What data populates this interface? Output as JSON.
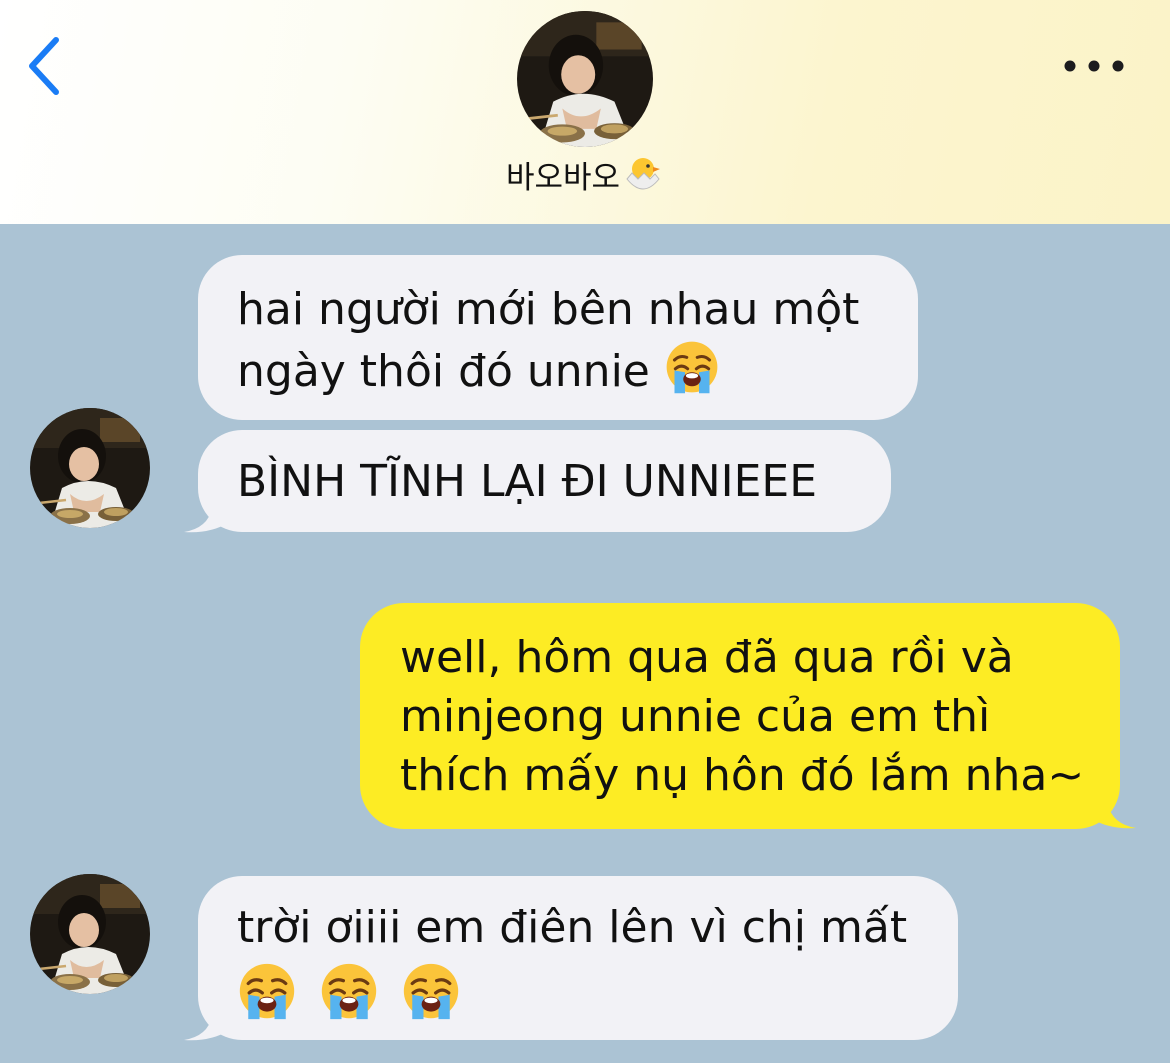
{
  "header": {
    "contact_name": "바오바오",
    "name_emoji": "hatching-chick-emoji"
  },
  "icons": {
    "back": "chevron-left-icon",
    "more": "ellipsis-icon",
    "crying": "loudly-crying-face-emoji"
  },
  "messages": [
    {
      "direction": "incoming",
      "lines": [
        "hai người mới bên nhau một",
        "ngày thôi đó unnie"
      ],
      "emoji_count": 1
    },
    {
      "direction": "incoming",
      "lines": [
        "BÌNH TĨNH LẠI ĐI UNNIEEE"
      ],
      "emoji_count": 0
    },
    {
      "direction": "outgoing",
      "lines": [
        "well, hôm qua đã qua rồi và",
        "minjeong unnie của em thì",
        "thích mấy nụ hôn đó lắm nha~"
      ],
      "emoji_count": 0
    },
    {
      "direction": "incoming",
      "lines": [
        "trời ơiiii em điên lên vì chị mất"
      ],
      "emoji_count": 3
    }
  ],
  "colors": {
    "accent": "#1a7cf5",
    "chat_background": "#abc3d4",
    "incoming_bubble": "#f2f2f6",
    "outgoing_bubble": "#fdec24"
  }
}
